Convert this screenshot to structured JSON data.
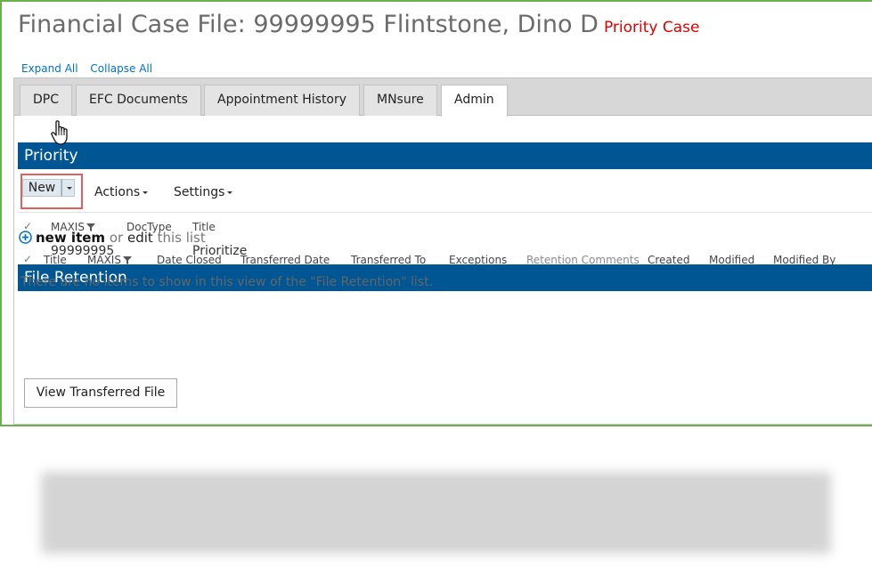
{
  "header": {
    "title": "Financial Case File: 99999995 Flintstone, Dino D",
    "priority_flag": "Priority Case"
  },
  "links": {
    "expand_all": "Expand All",
    "collapse_all": "Collapse All"
  },
  "tabs": [
    {
      "label": "DPC"
    },
    {
      "label": "EFC Documents"
    },
    {
      "label": "Appointment History"
    },
    {
      "label": "MNsure"
    },
    {
      "label": "Admin",
      "active": true
    }
  ],
  "priority": {
    "section_title": "Priority",
    "toolbar": {
      "new_label": "New",
      "actions_label": "Actions",
      "settings_label": "Settings"
    },
    "columns": [
      "MAXIS",
      "DocType",
      "Title"
    ],
    "rows": [
      {
        "maxis": "99999995",
        "doctype": "",
        "title": "Prioritize"
      }
    ]
  },
  "file_retention": {
    "section_title": "File Retention",
    "new_item": "new item",
    "or": "or",
    "edit": "edit",
    "this_list": "this list",
    "columns": [
      "Title",
      "MAXIS",
      "Date Closed",
      "Transferred Date",
      "Transferred To",
      "Exceptions",
      "Retention Comments",
      "Created",
      "Modified",
      "Modified By"
    ],
    "empty_message": "There are no items to show in this view of the \"File Retention\" list.",
    "view_button": "View Transferred File"
  },
  "colors": {
    "section_bar": "#005593",
    "link": "#0072c6",
    "priority_flag": "#e00000",
    "frame_border": "#6ab04c",
    "highlight_box": "#e06060"
  }
}
